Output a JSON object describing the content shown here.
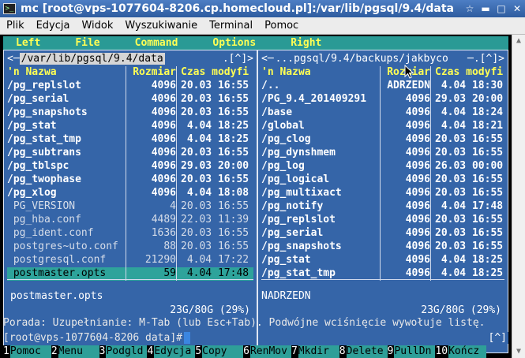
{
  "window": {
    "title": "mc [root@vps-1077604-8206.cp.homecloud.pl]:/var/lib/pgsql/9.4/data",
    "app_icon": ">_",
    "buttons": [
      "☆",
      "▬",
      "□",
      "✕"
    ]
  },
  "terminal_menu": [
    "Plik",
    "Edycja",
    "Widok",
    "Wyszukiwanie",
    "Terminal",
    "Pomoc"
  ],
  "mc_menu": [
    "Left",
    "File",
    "Command",
    "Options",
    "Right"
  ],
  "left_panel": {
    "corner": "<─",
    "path": "/var/lib/pgsql/9.4/data",
    "right_marks": ".[^]>",
    "columns": {
      "name": "'n     Nazwa",
      "size": "Rozmiar",
      "time": "Czas modyfi"
    },
    "rows": [
      {
        "name": "/pg_replslot",
        "size": "4096",
        "time": "20.03 16:55",
        "type": "dir"
      },
      {
        "name": "/pg_serial",
        "size": "4096",
        "time": "20.03 16:55",
        "type": "dir"
      },
      {
        "name": "/pg_snapshots",
        "size": "4096",
        "time": "20.03 16:55",
        "type": "dir"
      },
      {
        "name": "/pg_stat",
        "size": "4096",
        "time": " 4.04 18:25",
        "type": "dir"
      },
      {
        "name": "/pg_stat_tmp",
        "size": "4096",
        "time": " 4.04 18:25",
        "type": "dir"
      },
      {
        "name": "/pg_subtrans",
        "size": "4096",
        "time": "20.03 16:55",
        "type": "dir"
      },
      {
        "name": "/pg_tblspc",
        "size": "4096",
        "time": "29.03 20:00",
        "type": "dir"
      },
      {
        "name": "/pg_twophase",
        "size": "4096",
        "time": "20.03 16:55",
        "type": "dir"
      },
      {
        "name": "/pg_xlog",
        "size": "4096",
        "time": " 4.04 18:08",
        "type": "dir"
      },
      {
        "name": " PG_VERSION",
        "size": "4",
        "time": "20.03 16:55",
        "type": "file"
      },
      {
        "name": " pg_hba.conf",
        "size": "4489",
        "time": "22.03 11:39",
        "type": "file"
      },
      {
        "name": " pg_ident.conf",
        "size": "1636",
        "time": "20.03 16:55",
        "type": "file"
      },
      {
        "name": " postgres~uto.conf",
        "size": "88",
        "time": "20.03 16:55",
        "type": "file"
      },
      {
        "name": " postgresql.conf",
        "size": "21290",
        "time": " 4.04 17:22",
        "type": "file"
      },
      {
        "name": " postmaster.opts",
        "size": "59",
        "time": " 4.04 17:48",
        "type": "sel"
      }
    ],
    "mini_status": "postmaster.opts",
    "free": "23G/80G (29%)"
  },
  "right_panel": {
    "corner": "<─",
    "path": " ...pgsql/9.4/backups/jakbyco ",
    "right_marks": "─.[^]>",
    "columns": {
      "name": "'n     Nazwa",
      "size": "Rozmiar",
      "time": "Czas modyfi"
    },
    "rows": [
      {
        "name": "/..",
        "size": "ADRZEDN",
        "time": " 4.04 18:30",
        "type": "dir"
      },
      {
        "name": "/PG_9.4_201409291",
        "size": "4096",
        "time": "29.03 20:00",
        "type": "dir"
      },
      {
        "name": "/base",
        "size": "4096",
        "time": " 4.04 18:24",
        "type": "dir"
      },
      {
        "name": "/global",
        "size": "4096",
        "time": " 4.04 18:21",
        "type": "dir"
      },
      {
        "name": "/pg_clog",
        "size": "4096",
        "time": "20.03 16:55",
        "type": "dir"
      },
      {
        "name": "/pg_dynshmem",
        "size": "4096",
        "time": "20.03 16:55",
        "type": "dir"
      },
      {
        "name": "/pg_log",
        "size": "4096",
        "time": "26.03 00:00",
        "type": "dir"
      },
      {
        "name": "/pg_logical",
        "size": "4096",
        "time": "20.03 16:55",
        "type": "dir"
      },
      {
        "name": "/pg_multixact",
        "size": "4096",
        "time": "20.03 16:55",
        "type": "dir"
      },
      {
        "name": "/pg_notify",
        "size": "4096",
        "time": " 4.04 17:48",
        "type": "dir"
      },
      {
        "name": "/pg_replslot",
        "size": "4096",
        "time": "20.03 16:55",
        "type": "dir"
      },
      {
        "name": "/pg_serial",
        "size": "4096",
        "time": "20.03 16:55",
        "type": "dir"
      },
      {
        "name": "/pg_snapshots",
        "size": "4096",
        "time": "20.03 16:55",
        "type": "dir"
      },
      {
        "name": "/pg_stat",
        "size": "4096",
        "time": " 4.04 18:25",
        "type": "dir"
      },
      {
        "name": "/pg_stat_tmp",
        "size": "4096",
        "time": " 4.04 18:25",
        "type": "dir"
      }
    ],
    "mini_status": "NADRZEDN",
    "free": "23G/80G (29%)"
  },
  "hint": "Porada: Uzupełnianie: M-Tab (lub Esc+Tab). Podwójne wciśnięcie wywołuje listę.",
  "prompt": "[root@vps-1077604-8206 data]#",
  "prompt_arrow": "[^]",
  "fkeys": [
    {
      "n": "1",
      "label": "Pomoc"
    },
    {
      "n": "2",
      "label": "Menu"
    },
    {
      "n": "3",
      "label": "Podgld"
    },
    {
      "n": "4",
      "label": "Edycja"
    },
    {
      "n": "5",
      "label": "Copy"
    },
    {
      "n": "6",
      "label": "RenMov"
    },
    {
      "n": "7",
      "label": "Mkdir"
    },
    {
      "n": "8",
      "label": "Delete"
    },
    {
      "n": "9",
      "label": "PullDn"
    },
    {
      "n": "10",
      "label": "Kończ"
    }
  ],
  "scroll_arrows": {
    "up": "▲",
    "down": "▼"
  },
  "colors": {
    "panel_bg": "#3565a8",
    "header_yellow": "#ffff54",
    "selection_cyan": "#2ea39b",
    "titlebar_blue": "#2e5c9f"
  }
}
